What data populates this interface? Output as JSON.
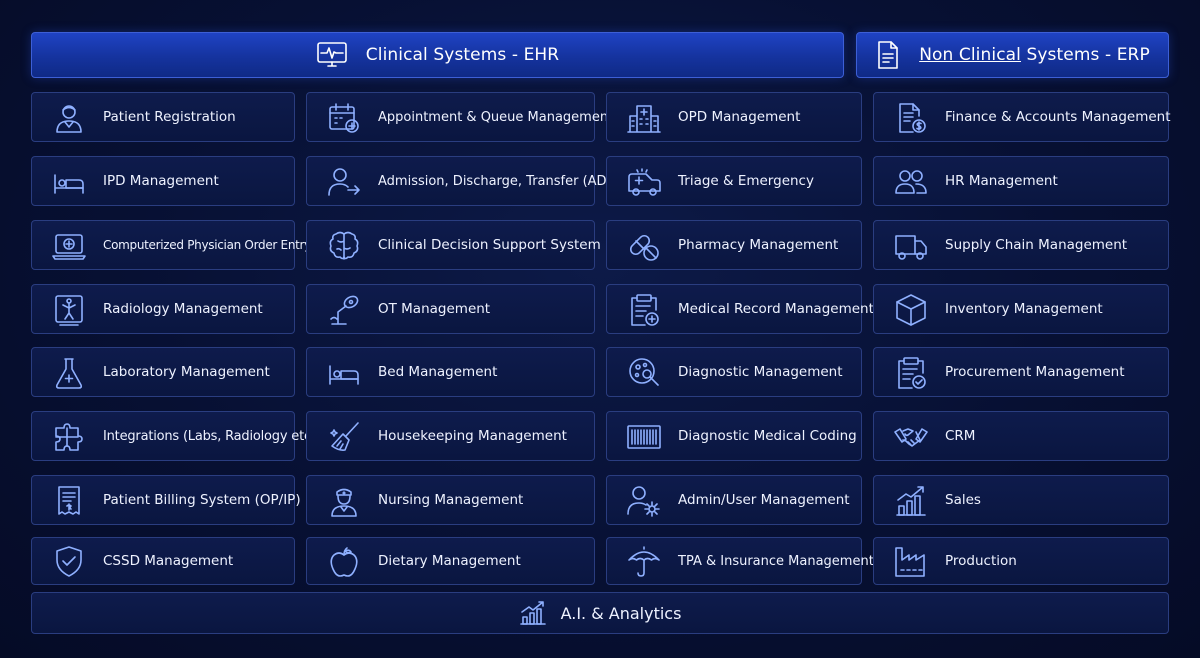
{
  "headers": {
    "ehr": {
      "title": "Clinical Systems - EHR",
      "icon": "monitor-heartbeat-icon"
    },
    "erp": {
      "title_underlined": "Non Clinical",
      "title_rest": " Systems - ERP",
      "icon": "document-list-icon"
    }
  },
  "columns": [
    [
      {
        "label": "Patient Registration",
        "icon": "patient-icon"
      },
      {
        "label": "IPD Management",
        "icon": "hospital-bed-icon"
      },
      {
        "label": "Computerized Physician Order Entry",
        "icon": "laptop-medical-icon"
      },
      {
        "label": "Radiology Management",
        "icon": "xray-icon"
      },
      {
        "label": "Laboratory Management",
        "icon": "flask-icon"
      },
      {
        "label": "Integrations (Labs, Radiology etc.)",
        "icon": "puzzle-icon"
      },
      {
        "label": "Patient Billing System (OP/IP)",
        "icon": "receipt-icon"
      },
      {
        "label": "CSSD Management",
        "icon": "shield-check-icon"
      }
    ],
    [
      {
        "label": "Appointment & Queue Management",
        "icon": "calendar-add-icon"
      },
      {
        "label": "Admission, Discharge, Transfer (ADT)",
        "icon": "user-transfer-icon"
      },
      {
        "label": "Clinical Decision Support System",
        "icon": "brain-icon"
      },
      {
        "label": "OT Management",
        "icon": "surgical-lamp-icon"
      },
      {
        "label": "Bed Management",
        "icon": "bed-icon"
      },
      {
        "label": "Housekeeping Management",
        "icon": "broom-icon"
      },
      {
        "label": "Nursing Management",
        "icon": "nurse-icon"
      },
      {
        "label": "Dietary Management",
        "icon": "apple-icon"
      }
    ],
    [
      {
        "label": "OPD Management",
        "icon": "hospital-building-icon"
      },
      {
        "label": "Triage & Emergency",
        "icon": "ambulance-icon"
      },
      {
        "label": "Pharmacy Management",
        "icon": "pills-icon"
      },
      {
        "label": "Medical Record Management",
        "icon": "clipboard-plus-icon"
      },
      {
        "label": "Diagnostic Management",
        "icon": "microscope-dish-icon"
      },
      {
        "label": "Diagnostic Medical Coding",
        "icon": "barcode-icon"
      },
      {
        "label": "Admin/User Management",
        "icon": "user-gear-icon"
      },
      {
        "label": "TPA & Insurance Management",
        "icon": "umbrella-icon"
      }
    ],
    [
      {
        "label": "Finance & Accounts Management",
        "icon": "invoice-dollar-icon"
      },
      {
        "label": "HR Management",
        "icon": "users-icon"
      },
      {
        "label": "Supply Chain Management",
        "icon": "truck-icon"
      },
      {
        "label": "Inventory Management",
        "icon": "box-icon"
      },
      {
        "label": "Procurement Management",
        "icon": "clipboard-check-icon"
      },
      {
        "label": "CRM",
        "icon": "handshake-icon"
      },
      {
        "label": "Sales",
        "icon": "chart-growth-icon"
      },
      {
        "label": "Production",
        "icon": "factory-icon"
      }
    ]
  ],
  "footer": {
    "title": "A.I. & Analytics",
    "icon": "analytics-chart-icon"
  }
}
